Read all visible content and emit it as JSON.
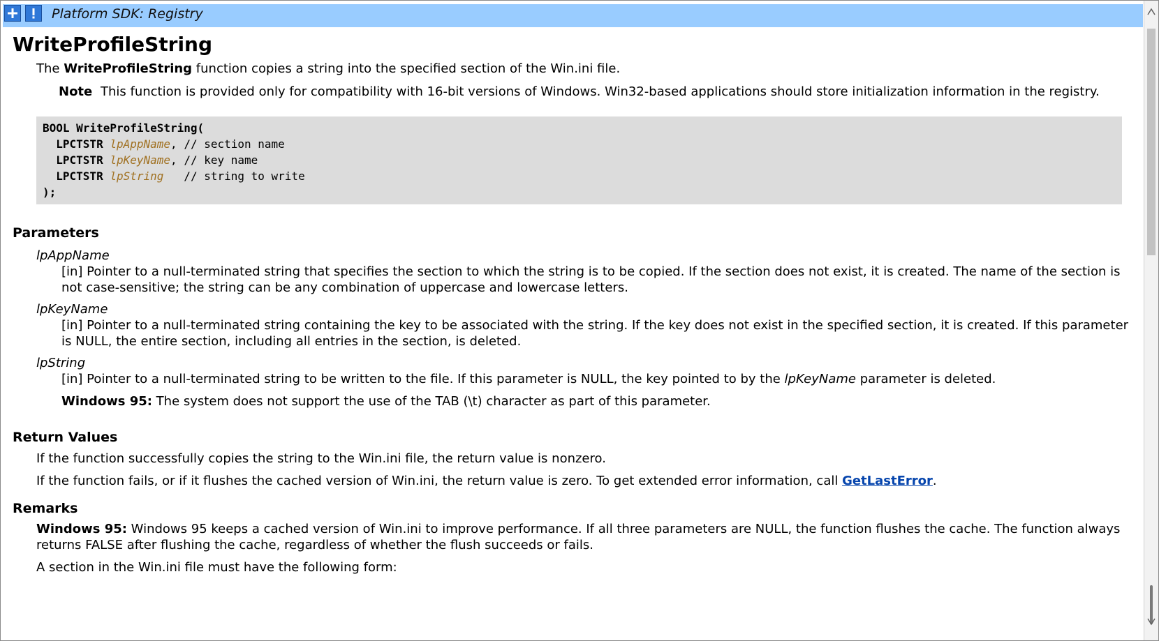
{
  "header": {
    "title": "Platform SDK: Registry",
    "plus_icon": "plus-icon",
    "exclamation_icon": "exclamation-icon"
  },
  "doc": {
    "title": "WriteProfileString",
    "intro_prefix": "The ",
    "intro_bold": "WriteProfileString",
    "intro_suffix": " function copies a string into the specified section of the Win.ini file.",
    "note_label": "Note",
    "note_text": "This function is provided only for compatibility with 16-bit versions of Windows. Win32-based applications should store initialization information in the registry.",
    "code": {
      "line1": "BOOL WriteProfileString(",
      "type": "LPCTSTR",
      "param1": "lpAppName",
      "comment1": ", // section name",
      "param2": "lpKeyName",
      "comment2": ", // key name",
      "param3": "lpString",
      "comment3": "   // string to write",
      "end": ");"
    },
    "parameters_heading": "Parameters",
    "parameters": [
      {
        "name": "lpAppName",
        "desc": "[in] Pointer to a null-terminated string that specifies the section to which the string is to be copied. If the section does not exist, it is created. The name of the section is not case-sensitive; the string can be any combination of uppercase and lowercase letters."
      },
      {
        "name": "lpKeyName",
        "desc": "[in] Pointer to a null-terminated string containing the key to be associated with the string. If the key does not exist in the specified section, it is created. If this parameter is NULL, the entire section, including all entries in the section, is deleted."
      },
      {
        "name": "lpString",
        "desc_prefix": "[in] Pointer to a null-terminated string to be written to the file. If this parameter is NULL, the key pointed to by the ",
        "desc_italic": "lpKeyName",
        "desc_suffix": " parameter is deleted.",
        "w95_label": "Windows 95:",
        "w95_text": " The system does not support the use of the TAB (\\t) character as part of this parameter."
      }
    ],
    "return_heading": "Return Values",
    "return1": "If the function successfully copies the string to the Win.ini file, the return value is nonzero.",
    "return2_prefix": "If the function fails, or if it flushes the cached version of Win.ini, the return value is zero. To get extended error information, call ",
    "return2_link": "GetLastError",
    "return2_suffix": ".",
    "remarks_heading": "Remarks",
    "remarks_w95_label": "Windows 95:",
    "remarks_w95_text": " Windows 95 keeps a cached version of Win.ini to improve performance. If all three parameters are NULL, the function flushes the cache. The function always returns FALSE after flushing the cache, regardless of whether the flush succeeds or fails.",
    "remarks2": "A section in the Win.ini file must have the following form:"
  }
}
